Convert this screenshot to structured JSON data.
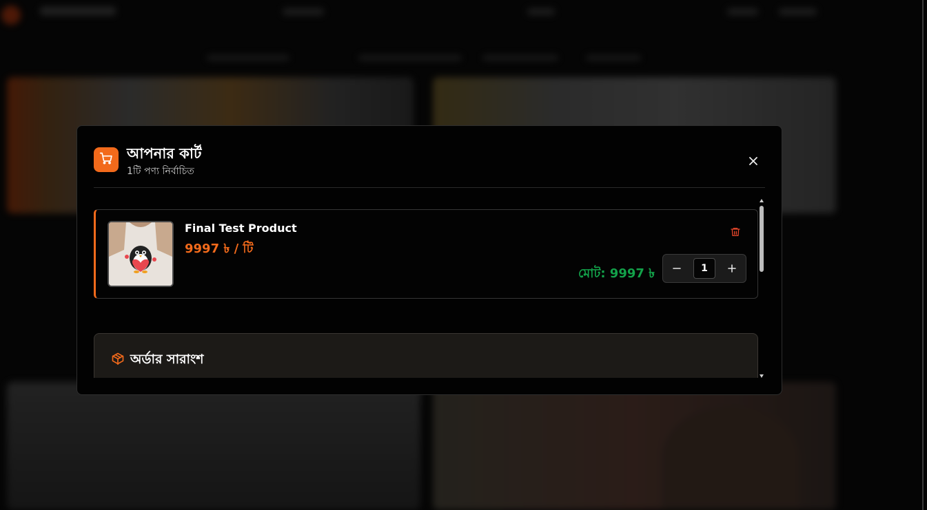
{
  "cart": {
    "title": "আপনার কার্ট",
    "subtitle": "1টি পণ্য নির্বাচিত",
    "icons": {
      "cart": "shopping-cart-icon",
      "close": "close-icon",
      "trash": "trash-icon",
      "package": "package-icon"
    },
    "accent_color": "#f26a1b",
    "total_color": "#13a24a"
  },
  "items": [
    {
      "name": "Final Test Product",
      "price": "9997 ৳ / টি",
      "total": "মোট: 9997 ৳",
      "quantity": "1",
      "thumbnail": "penguin-tshirt-image"
    }
  ],
  "summary": {
    "title": "অর্ডার সারাংশ"
  }
}
